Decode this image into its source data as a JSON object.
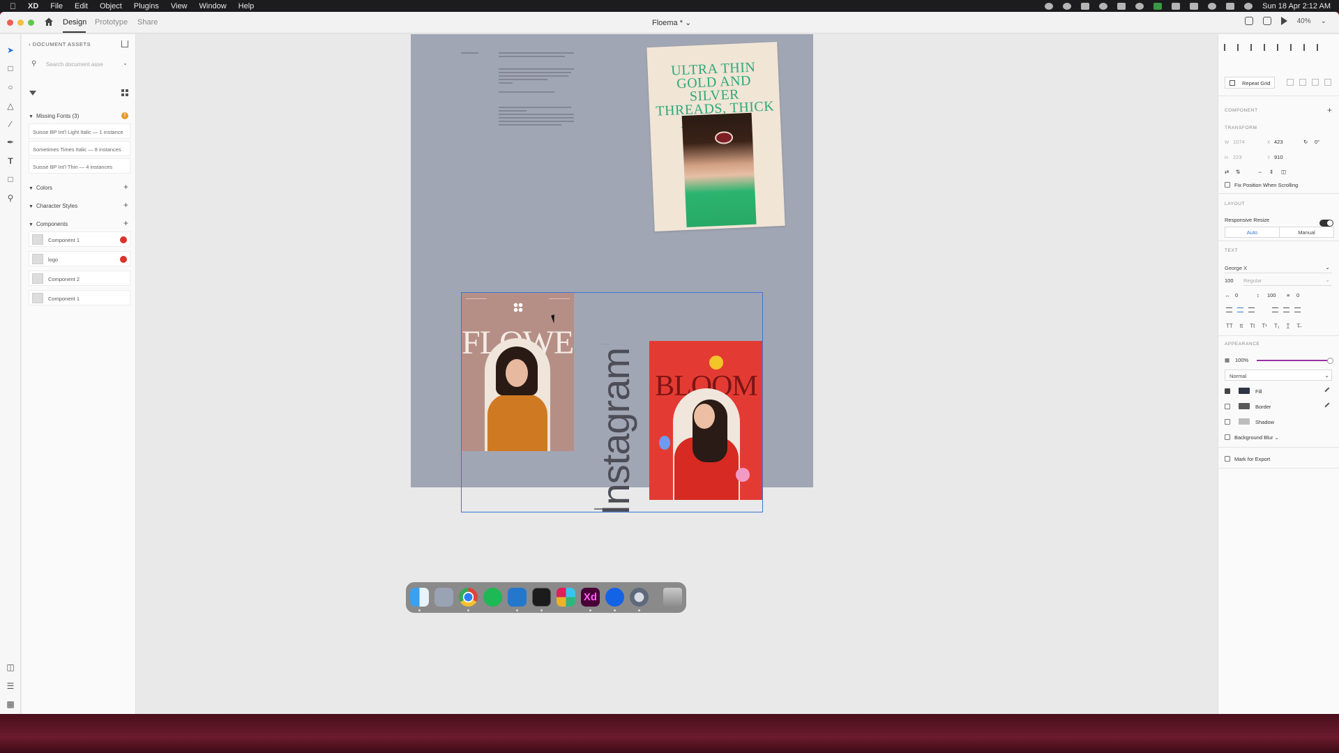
{
  "menubar": {
    "app": "XD",
    "menus": [
      "File",
      "Edit",
      "Object",
      "Plugins",
      "View",
      "Window",
      "Help"
    ],
    "clock": "Sun 18 Apr  2:12 AM"
  },
  "titlebar": {
    "tabs": [
      "Design",
      "Prototype",
      "Share"
    ],
    "active_tab": "Design",
    "doc_title": "Floema *",
    "zoom": "40%"
  },
  "assets": {
    "header": "DOCUMENT ASSETS",
    "search_placeholder": "Search document asse",
    "missing_fonts_label": "Missing Fonts (3)",
    "missing_fonts_badge": "!",
    "missing_fonts": [
      "Suisse BP Int'l Light Italic — 1 instance",
      "Sometimes Times Italic — 8 instances",
      "Suisse BP Int'l Thin — 4 instances"
    ],
    "sections": [
      "Colors",
      "Character Styles",
      "Components"
    ],
    "components": [
      {
        "name": "Component 1",
        "broken": true
      },
      {
        "name": "logo",
        "broken": true
      },
      {
        "name": "Component 2",
        "broken": false
      },
      {
        "name": "Component 1",
        "broken": false
      }
    ]
  },
  "canvas": {
    "poster1_headline": "ULTRA THIN GOLD AND SILVER THREADS, THICK AS HAIRS.",
    "poster2_word": "FLOWER",
    "poster3_word": "BLOOM",
    "vertical_word": "Instagram"
  },
  "inspector": {
    "repeat_grid": "Repeat Grid",
    "component_label": "COMPONENT",
    "transform_label": "TRANSFORM",
    "w_label": "W",
    "w_value": "1074",
    "h_label": "H",
    "h_value": "223",
    "x_label": "X",
    "x_value": "423",
    "y_label": "Y",
    "y_value": "910",
    "rotation": "0°",
    "fix_position": "Fix Position When Scrolling",
    "layout_label": "LAYOUT",
    "responsive_resize": "Responsive Resize",
    "auto": "Auto",
    "manual": "Manual",
    "text_label": "TEXT",
    "font_family": "George X",
    "font_size": "100",
    "font_weight": "Regular",
    "char_spacing": "0",
    "line_spacing": "100",
    "para_spacing": "0",
    "appearance_label": "APPEARANCE",
    "opacity": "100%",
    "blend_mode": "Normal",
    "fill_label": "Fill",
    "border_label": "Border",
    "shadow_label": "Shadow",
    "bg_blur_label": "Background Blur",
    "export_label": "Mark for Export",
    "fill_color": "#2f3444",
    "border_color": "#5a5a5a"
  },
  "dock": {
    "apps": [
      "finder-icon",
      "launchpad-icon",
      "chrome-icon",
      "spotify-icon",
      "vscode-icon",
      "terminal-icon",
      "slack-icon",
      "xd-icon",
      "maps-pin-icon",
      "quicktime-icon",
      "trash-icon"
    ]
  }
}
